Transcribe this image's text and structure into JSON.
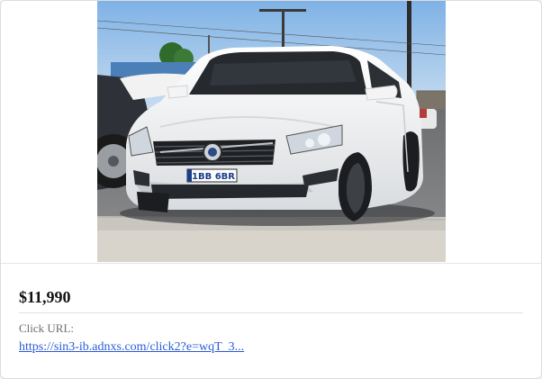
{
  "ad": {
    "image_alt": "White Volvo sedan with licence plate 1BB 6BR",
    "plate_text": "1BB 6BR",
    "price": "$11,990",
    "click_label": "Click URL:",
    "click_url": "https://sin3-ib.adnxs.com/click2?e=wqT_3..."
  }
}
